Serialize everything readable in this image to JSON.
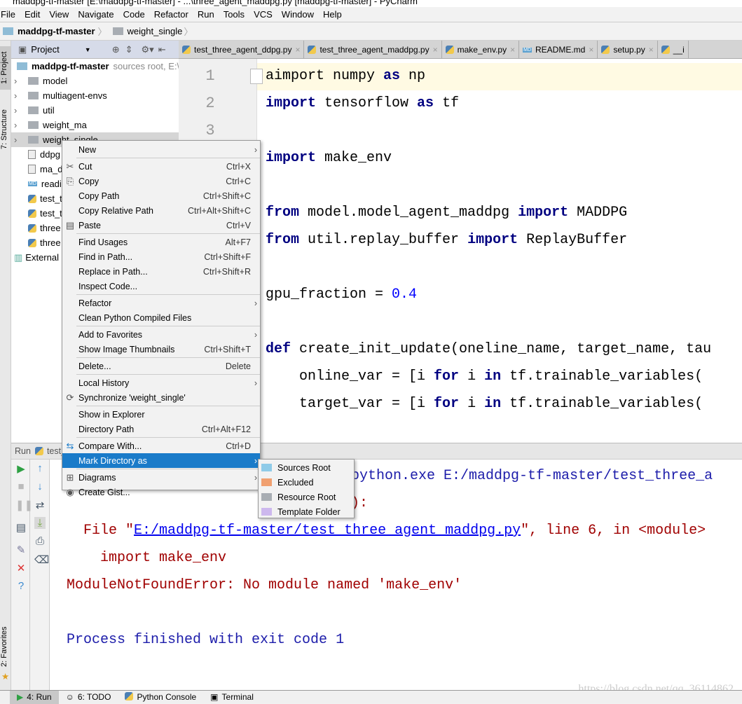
{
  "window": {
    "title": "maddpg-tf-master [E:\\maddpg-tf-master] - ...\\three_agent_maddpg.py [maddpg-tf-master] - PyCharm"
  },
  "menu": [
    "File",
    "Edit",
    "View",
    "Navigate",
    "Code",
    "Refactor",
    "Run",
    "Tools",
    "VCS",
    "Window",
    "Help"
  ],
  "breadcrumb": [
    "maddpg-tf-master",
    "weight_single"
  ],
  "side_tabs": {
    "project": "1: Project",
    "structure": "7: Structure",
    "favorites": "2: Favorites"
  },
  "project_panel": {
    "title": "Project",
    "root": {
      "name": "maddpg-tf-master",
      "hint": "sources root, E:\\"
    },
    "items": [
      {
        "name": "model",
        "type": "folder"
      },
      {
        "name": "multiagent-envs",
        "type": "folder"
      },
      {
        "name": "util",
        "type": "folder"
      },
      {
        "name": "weight_ma",
        "type": "folder"
      },
      {
        "name": "weight_single",
        "type": "folder",
        "selected": true
      },
      {
        "name": "ddpg",
        "type": "file"
      },
      {
        "name": "ma_d",
        "type": "file"
      },
      {
        "name": "readi",
        "type": "md"
      },
      {
        "name": "test_t",
        "type": "py"
      },
      {
        "name": "test_t",
        "type": "py"
      },
      {
        "name": "three",
        "type": "py"
      },
      {
        "name": "three",
        "type": "py"
      }
    ],
    "external": "External"
  },
  "tabs": [
    "test_three_agent_ddpg.py",
    "test_three_agent_maddpg.py",
    "make_env.py",
    "README.md",
    "setup.py",
    "__i"
  ],
  "editor": {
    "line_numbers": [
      "1",
      "2",
      "3"
    ],
    "lines": [
      [
        {
          "t": "aimport ",
          "c": ""
        },
        {
          "t": "numpy ",
          "c": ""
        },
        {
          "t": "as",
          "c": "kw"
        },
        {
          "t": " np",
          "c": ""
        }
      ],
      [
        {
          "t": "import",
          "c": "kw"
        },
        {
          "t": " tensorflow ",
          "c": ""
        },
        {
          "t": "as",
          "c": "kw"
        },
        {
          "t": " tf",
          "c": ""
        }
      ],
      [],
      [
        {
          "t": "import",
          "c": "kw"
        },
        {
          "t": " make_env",
          "c": ""
        }
      ],
      [],
      [
        {
          "t": "from",
          "c": "kw"
        },
        {
          "t": " model.model_agent_maddpg ",
          "c": ""
        },
        {
          "t": "import",
          "c": "kw"
        },
        {
          "t": " MADDPG",
          "c": ""
        }
      ],
      [
        {
          "t": "from",
          "c": "kw"
        },
        {
          "t": " util.replay_buffer ",
          "c": ""
        },
        {
          "t": "import",
          "c": "kw"
        },
        {
          "t": " ReplayBuffer",
          "c": ""
        }
      ],
      [],
      [
        {
          "t": "gpu_fraction = ",
          "c": ""
        },
        {
          "t": "0.4",
          "c": "num"
        }
      ],
      [],
      [
        {
          "t": "def",
          "c": "kw"
        },
        {
          "t": " create_init_update(oneline_name, target_name, tau",
          "c": ""
        }
      ],
      [
        {
          "t": "    online_var = [i ",
          "c": ""
        },
        {
          "t": "for",
          "c": "kw"
        },
        {
          "t": " i ",
          "c": ""
        },
        {
          "t": "in",
          "c": "kw"
        },
        {
          "t": " tf.trainable_variables(",
          "c": ""
        }
      ],
      [
        {
          "t": "    target_var = [i ",
          "c": ""
        },
        {
          "t": "for",
          "c": "kw"
        },
        {
          "t": " i ",
          "c": ""
        },
        {
          "t": "in",
          "c": "kw"
        },
        {
          "t": " tf.trainable_variables(",
          "c": ""
        }
      ]
    ]
  },
  "run": {
    "label": "Run",
    "config": "test_",
    "output": {
      "cmd": "python.exe E:/maddpg-tf-master/test_three_a",
      "traceback": "):",
      "file_prefix": "  File \"",
      "file_link": "E:/maddpg-tf-master/test_three_agent_maddpg.py",
      "file_suffix": "\", line 6, in <module>",
      "import_line": "    import make_env",
      "error": "ModuleNotFoundError: No module named 'make_env'",
      "finished": "Process finished with exit code 1"
    }
  },
  "context_menu": [
    {
      "label": "New",
      "submenu": true
    },
    {
      "sep": true
    },
    {
      "label": "Cut",
      "shortcut": "Ctrl+X",
      "icon": "scissors-icon"
    },
    {
      "label": "Copy",
      "shortcut": "Ctrl+C",
      "icon": "copy-icon"
    },
    {
      "label": "Copy Path",
      "shortcut": "Ctrl+Shift+C"
    },
    {
      "label": "Copy Relative Path",
      "shortcut": "Ctrl+Alt+Shift+C"
    },
    {
      "label": "Paste",
      "shortcut": "Ctrl+V",
      "icon": "paste-icon"
    },
    {
      "sep": true
    },
    {
      "label": "Find Usages",
      "shortcut": "Alt+F7"
    },
    {
      "label": "Find in Path...",
      "shortcut": "Ctrl+Shift+F"
    },
    {
      "label": "Replace in Path...",
      "shortcut": "Ctrl+Shift+R"
    },
    {
      "label": "Inspect Code..."
    },
    {
      "sep": true
    },
    {
      "label": "Refactor",
      "submenu": true
    },
    {
      "label": "Clean Python Compiled Files"
    },
    {
      "sep": true
    },
    {
      "label": "Add to Favorites",
      "submenu": true
    },
    {
      "label": "Show Image Thumbnails",
      "shortcut": "Ctrl+Shift+T"
    },
    {
      "sep": true
    },
    {
      "label": "Delete...",
      "shortcut": "Delete"
    },
    {
      "sep": true
    },
    {
      "label": "Local History",
      "submenu": true
    },
    {
      "label": "Synchronize 'weight_single'",
      "icon": "sync-icon"
    },
    {
      "sep": true
    },
    {
      "label": "Show in Explorer"
    },
    {
      "label": "Directory Path",
      "shortcut": "Ctrl+Alt+F12"
    },
    {
      "sep": true
    },
    {
      "label": "Compare With...",
      "shortcut": "Ctrl+D",
      "icon": "compare-icon"
    },
    {
      "label": "Mark Directory as",
      "submenu": true,
      "highlighted": true
    },
    {
      "sep": true
    },
    {
      "label": "Diagrams",
      "submenu": true,
      "icon": "diagram-icon"
    },
    {
      "label": "Create Gist...",
      "icon": "github-icon"
    }
  ],
  "submenu": [
    {
      "label": "Sources Root",
      "color": "#8fcbe8"
    },
    {
      "label": "Excluded",
      "color": "#f0a070"
    },
    {
      "label": "Resource Root",
      "color": "#a8adb3"
    },
    {
      "label": "Template Folder",
      "color": "#cdb8ee"
    }
  ],
  "bottom_tabs": [
    "4: Run",
    "6: TODO",
    "Python Console",
    "Terminal"
  ],
  "watermark": "https://blog.csdn.net/qq_36114862"
}
